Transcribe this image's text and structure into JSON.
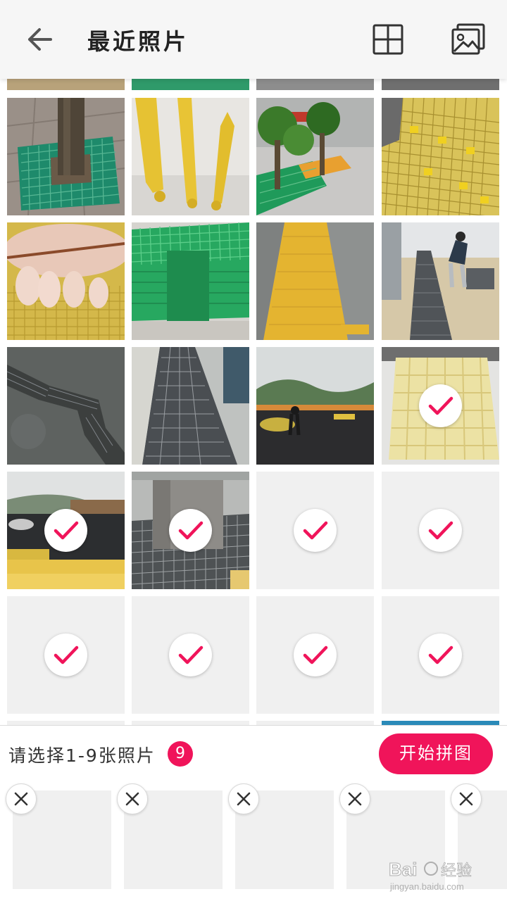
{
  "header": {
    "title": "最近照片",
    "back_icon": "arrow-left-icon",
    "grid_icon": "grid-icon",
    "gallery_icon": "gallery-icon"
  },
  "selection": {
    "prompt": "请选择1-9张照片",
    "count": "9",
    "start_label": "开始拼图"
  },
  "colors": {
    "accent": "#f0145a",
    "header_bg": "#f6f6f6",
    "placeholder": "#f0f0f0"
  },
  "photos": [
    {
      "subject": "green grating tree guard",
      "selected": false
    },
    {
      "subject": "yellow fiberglass posts",
      "selected": false
    },
    {
      "subject": "planters on green grating",
      "selected": false
    },
    {
      "subject": "yellow grating wall",
      "selected": false
    },
    {
      "subject": "piglets on yellow grating",
      "selected": false
    },
    {
      "subject": "stacked green grating",
      "selected": false
    },
    {
      "subject": "yellow floor grating",
      "selected": false
    },
    {
      "subject": "worker installing trench grating",
      "selected": false
    },
    {
      "subject": "zigzag floor grating",
      "selected": false
    },
    {
      "subject": "long drainage grating",
      "selected": false
    },
    {
      "subject": "rooftop site",
      "selected": false
    },
    {
      "subject": "yellow fence",
      "selected": true
    },
    {
      "subject": "rooftop construction",
      "selected": true
    },
    {
      "subject": "grating around column",
      "selected": true
    },
    {
      "subject": "",
      "selected": true
    },
    {
      "subject": "",
      "selected": true
    },
    {
      "subject": "",
      "selected": true
    },
    {
      "subject": "",
      "selected": true
    },
    {
      "subject": "",
      "selected": true
    },
    {
      "subject": "",
      "selected": true
    }
  ],
  "selected_thumbs": 5,
  "watermark": {
    "brand": "Bai经验",
    "url": "jingyan.baidu.com"
  }
}
